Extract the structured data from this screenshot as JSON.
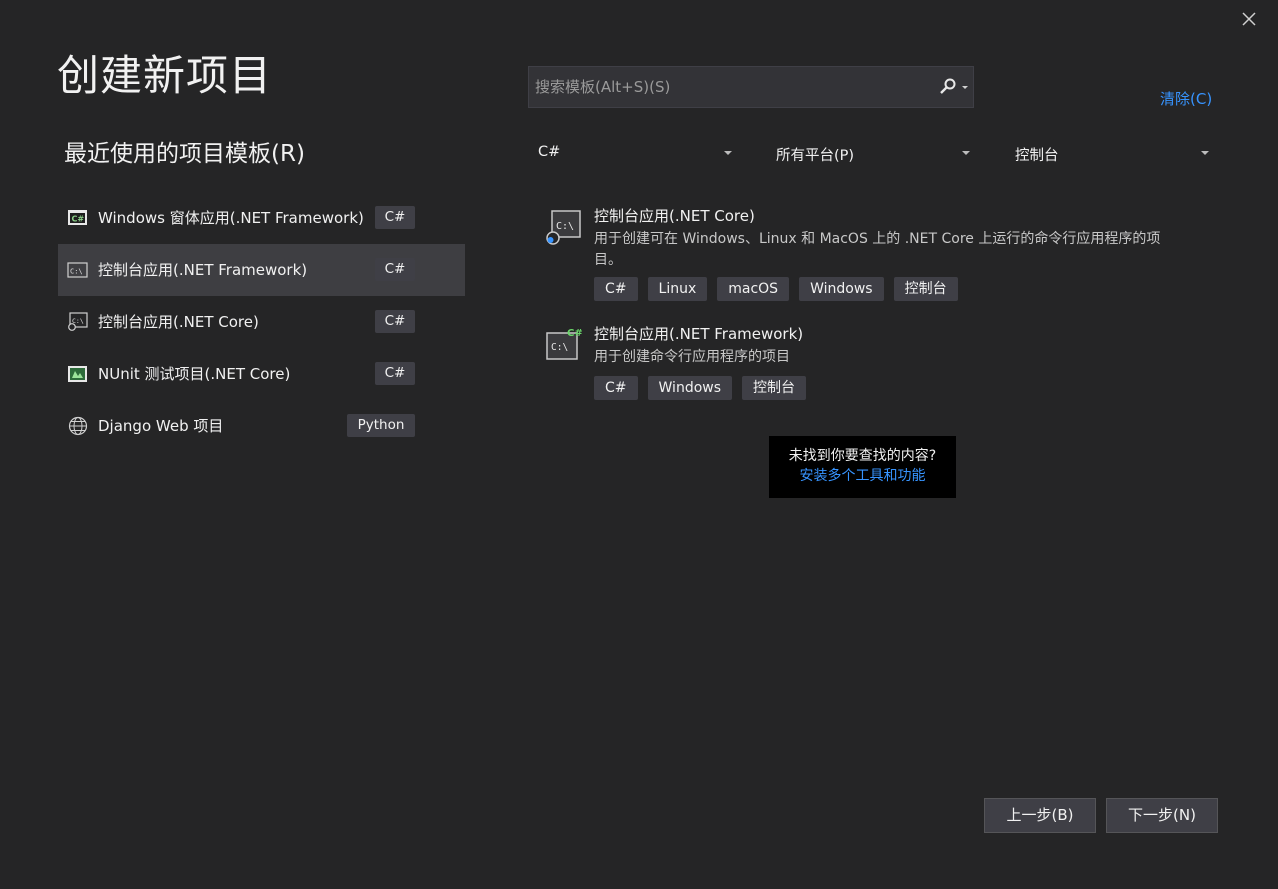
{
  "page_title": "创建新项目",
  "close_icon": "close-icon",
  "recent": {
    "title": "最近使用的项目模板(R)",
    "items": [
      {
        "label": "Windows 窗体应用(.NET Framework)",
        "lang": "C#",
        "icon": "winforms-csharp-icon"
      },
      {
        "label": "控制台应用(.NET Framework)",
        "lang": "C#",
        "icon": "console-app-icon",
        "selected": true
      },
      {
        "label": "控制台应用(.NET Core)",
        "lang": "C#",
        "icon": "console-core-icon"
      },
      {
        "label": "NUnit 测试项目(.NET Core)",
        "lang": "C#",
        "icon": "nunit-test-icon"
      },
      {
        "label": "Django Web 项目",
        "lang": "Python",
        "icon": "globe-icon"
      }
    ]
  },
  "search": {
    "placeholder": "搜索模板(Alt+S)(S)",
    "value": ""
  },
  "clear_label": "清除(C)",
  "filters": {
    "language": "C#",
    "platform": "所有平台(P)",
    "project_type": "控制台"
  },
  "templates": [
    {
      "title": "控制台应用(.NET Core)",
      "description": "用于创建可在 Windows、Linux 和 MacOS 上的 .NET Core 上运行的命令行应用程序的项目。",
      "tags": [
        "C#",
        "Linux",
        "macOS",
        "Windows",
        "控制台"
      ],
      "icon": "console-core-icon"
    },
    {
      "title": "控制台应用(.NET Framework)",
      "description": "用于创建命令行应用程序的项目",
      "tags": [
        "C#",
        "Windows",
        "控制台"
      ],
      "icon": "console-csharp-icon"
    }
  ],
  "not_found": {
    "question": "未找到你要查找的内容?",
    "link": "安装多个工具和功能"
  },
  "buttons": {
    "back": "上一步(B)",
    "next": "下一步(N)"
  },
  "colors": {
    "background": "#252526",
    "selected_row": "#3e3e42",
    "badge": "#3f3f46",
    "link": "#3794ff"
  }
}
